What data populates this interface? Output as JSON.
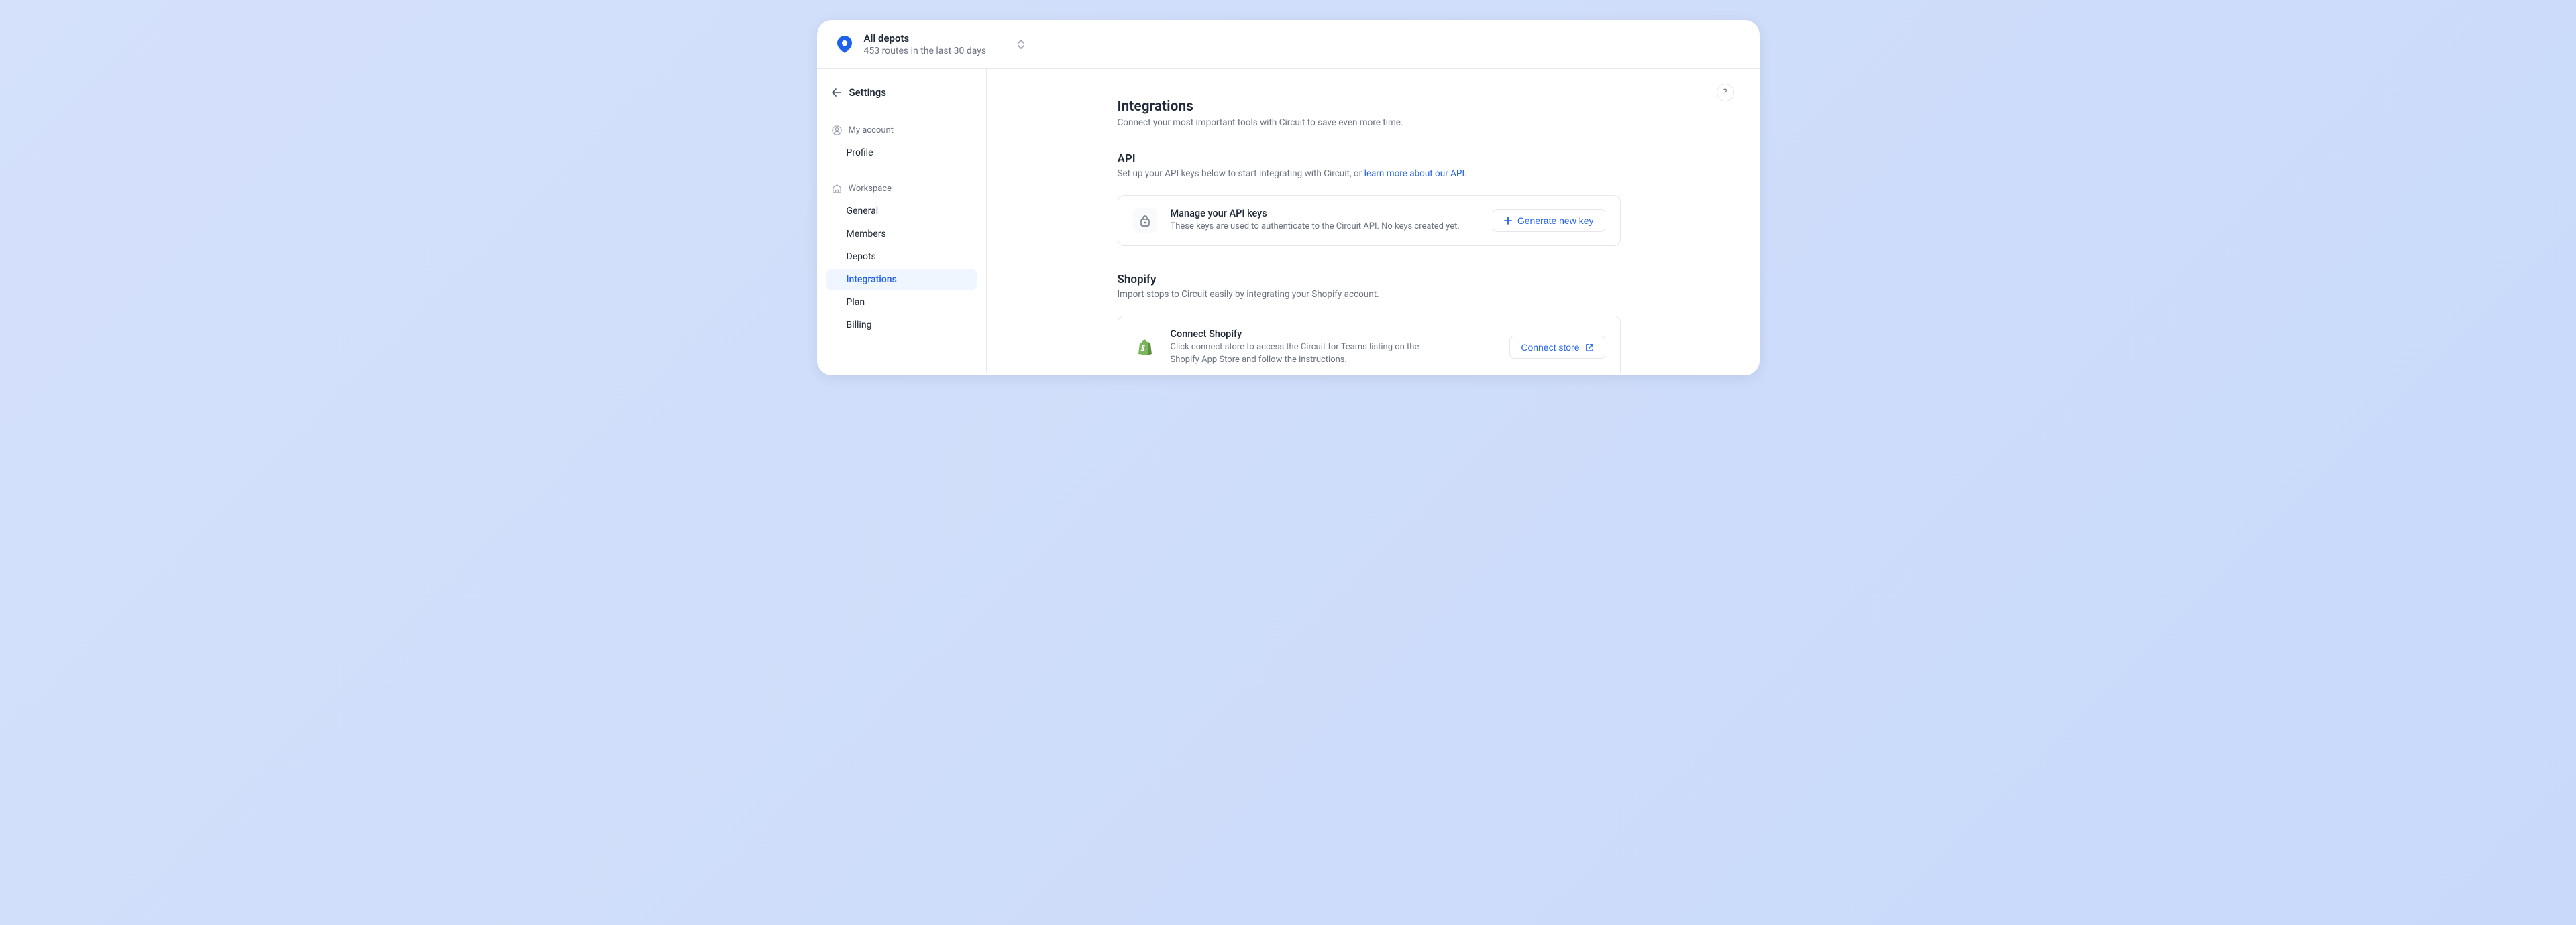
{
  "header": {
    "depot_title": "All depots",
    "depot_subtitle": "453 routes in the last 30 days"
  },
  "sidebar": {
    "back_label": "Settings",
    "sections": {
      "account": {
        "label": "My account",
        "items": [
          {
            "label": "Profile"
          }
        ]
      },
      "workspace": {
        "label": "Workspace",
        "items": [
          {
            "label": "General"
          },
          {
            "label": "Members"
          },
          {
            "label": "Depots"
          },
          {
            "label": "Integrations"
          },
          {
            "label": "Plan"
          },
          {
            "label": "Billing"
          }
        ]
      }
    }
  },
  "main": {
    "title": "Integrations",
    "subtitle": "Connect your most important tools with Circuit to save even more time.",
    "help_label": "?",
    "api": {
      "heading": "API",
      "desc_prefix": "Set up your API keys below to start integrating with Circuit, or ",
      "link_text": "learn more about our API",
      "desc_suffix": ".",
      "card_title": "Manage your API keys",
      "card_desc": "These keys are used to authenticate to the Circuit API. No keys created yet.",
      "button_label": "Generate new key"
    },
    "shopify": {
      "heading": "Shopify",
      "desc": "Import stops to Circuit easily by integrating your Shopify account.",
      "card_title": "Connect Shopify",
      "card_desc": "Click connect store to access the Circuit for Teams listing on the Shopify App Store and follow the instructions.",
      "button_label": "Connect store"
    }
  }
}
